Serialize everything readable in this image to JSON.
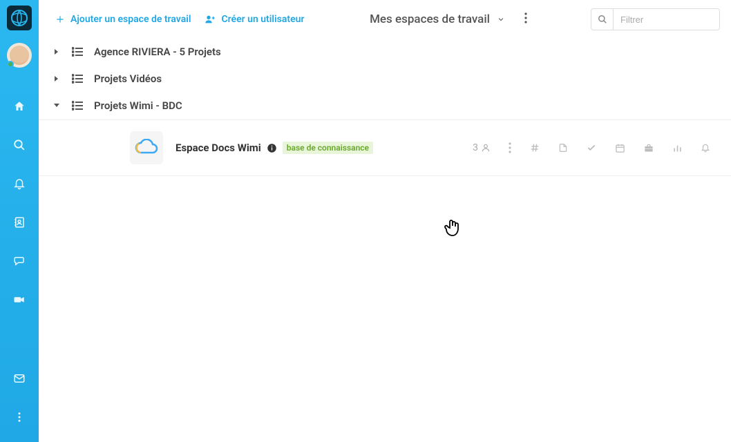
{
  "topbar": {
    "add_workspace": "Ajouter un espace de travail",
    "create_user": "Créer un utilisateur",
    "dropdown_label": "Mes espaces de travail",
    "search_placeholder": "Filtrer"
  },
  "categories": [
    {
      "title": "Agence RIVIERA - 5 Projets",
      "expanded": false
    },
    {
      "title": "Projets Vidéos",
      "expanded": false
    },
    {
      "title": "Projets Wimi - BDC",
      "expanded": true
    }
  ],
  "workspace": {
    "name": "Espace Docs Wimi",
    "tag": "base de connaissance",
    "member_count": "3"
  }
}
